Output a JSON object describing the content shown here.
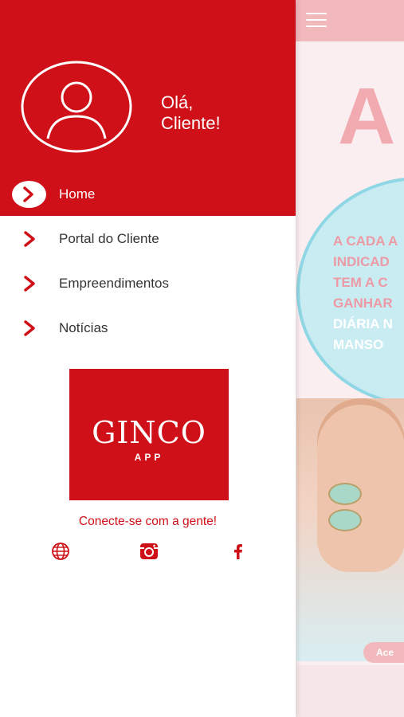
{
  "background": {
    "promo_lines": [
      "A CADA A",
      "INDICAD",
      "TEM A C",
      "GANHAR"
    ],
    "promo_white_lines": [
      "DIÁRIA N",
      "MANSO"
    ],
    "big_letter": "A",
    "button_partial": "Ace"
  },
  "drawer": {
    "greeting_line1": "Olá,",
    "greeting_line2": "Cliente!",
    "nav": [
      {
        "label": "Home",
        "active": true
      },
      {
        "label": "Portal do Cliente",
        "active": false
      },
      {
        "label": "Empreendimentos",
        "active": false
      },
      {
        "label": "Notícias",
        "active": false
      }
    ],
    "logo": {
      "word": "GINCO",
      "sub": "APP"
    },
    "connect_text": "Conecte-se com a gente!",
    "social": [
      "globe-icon",
      "instagram-icon",
      "facebook-icon"
    ]
  },
  "colors": {
    "brand_red": "#d01018",
    "text_dark": "#333333"
  }
}
